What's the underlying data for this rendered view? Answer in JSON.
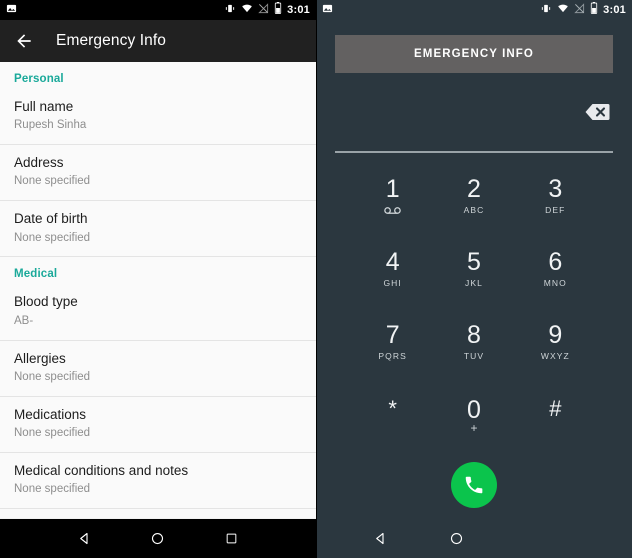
{
  "left_phone": {
    "status_bar": {
      "time": "3:01",
      "icons": [
        "screenshot-icon",
        "vibrate-icon",
        "wifi-icon",
        "cellular-off-icon",
        "battery-icon"
      ]
    },
    "toolbar": {
      "back_icon": "back-arrow-icon",
      "title": "Emergency Info"
    },
    "sections": [
      {
        "header": "Personal",
        "items": [
          {
            "title": "Full name",
            "value": "Rupesh Sinha"
          },
          {
            "title": "Address",
            "value": "None specified"
          },
          {
            "title": "Date of birth",
            "value": "None specified"
          }
        ]
      },
      {
        "header": "Medical",
        "items": [
          {
            "title": "Blood type",
            "value": "AB-"
          },
          {
            "title": "Allergies",
            "value": "None specified"
          },
          {
            "title": "Medications",
            "value": "None specified"
          },
          {
            "title": "Medical conditions and notes",
            "value": "None specified"
          }
        ]
      }
    ],
    "nav_bar": {
      "back": "back-triangle-icon",
      "home": "home-circle-icon",
      "recents": "recents-square-icon"
    }
  },
  "right_phone": {
    "status_bar": {
      "time": "3:01",
      "icons": [
        "screenshot-icon",
        "vibrate-icon",
        "wifi-icon",
        "cellular-off-icon",
        "battery-icon"
      ]
    },
    "emergency_button_label": "EMERGENCY INFO",
    "dialer_input": {
      "value": "",
      "backspace_icon": "backspace-icon"
    },
    "keypad": [
      {
        "digit": "1",
        "sub": "",
        "icon": "voicemail-icon"
      },
      {
        "digit": "2",
        "sub": "ABC",
        "icon": ""
      },
      {
        "digit": "3",
        "sub": "DEF",
        "icon": ""
      },
      {
        "digit": "4",
        "sub": "GHI",
        "icon": ""
      },
      {
        "digit": "5",
        "sub": "JKL",
        "icon": ""
      },
      {
        "digit": "6",
        "sub": "MNO",
        "icon": ""
      },
      {
        "digit": "7",
        "sub": "PQRS",
        "icon": ""
      },
      {
        "digit": "8",
        "sub": "TUV",
        "icon": ""
      },
      {
        "digit": "9",
        "sub": "WXYZ",
        "icon": ""
      },
      {
        "digit": "*",
        "sub": "",
        "icon": ""
      },
      {
        "digit": "0",
        "sub": "+",
        "icon": ""
      },
      {
        "digit": "#",
        "sub": "",
        "icon": ""
      }
    ],
    "call_button": {
      "icon": "phone-call-icon",
      "color": "#0bc44c"
    },
    "nav_bar": {
      "back": "back-triangle-icon",
      "home": "home-circle-icon"
    }
  },
  "colors": {
    "accent_teal": "#1aa99a",
    "dark_bg": "#2b373f",
    "toolbar_dark": "#212121",
    "list_bg": "#fafafa",
    "call_green": "#0bc44c",
    "emergency_btn_gray": "#636161"
  }
}
